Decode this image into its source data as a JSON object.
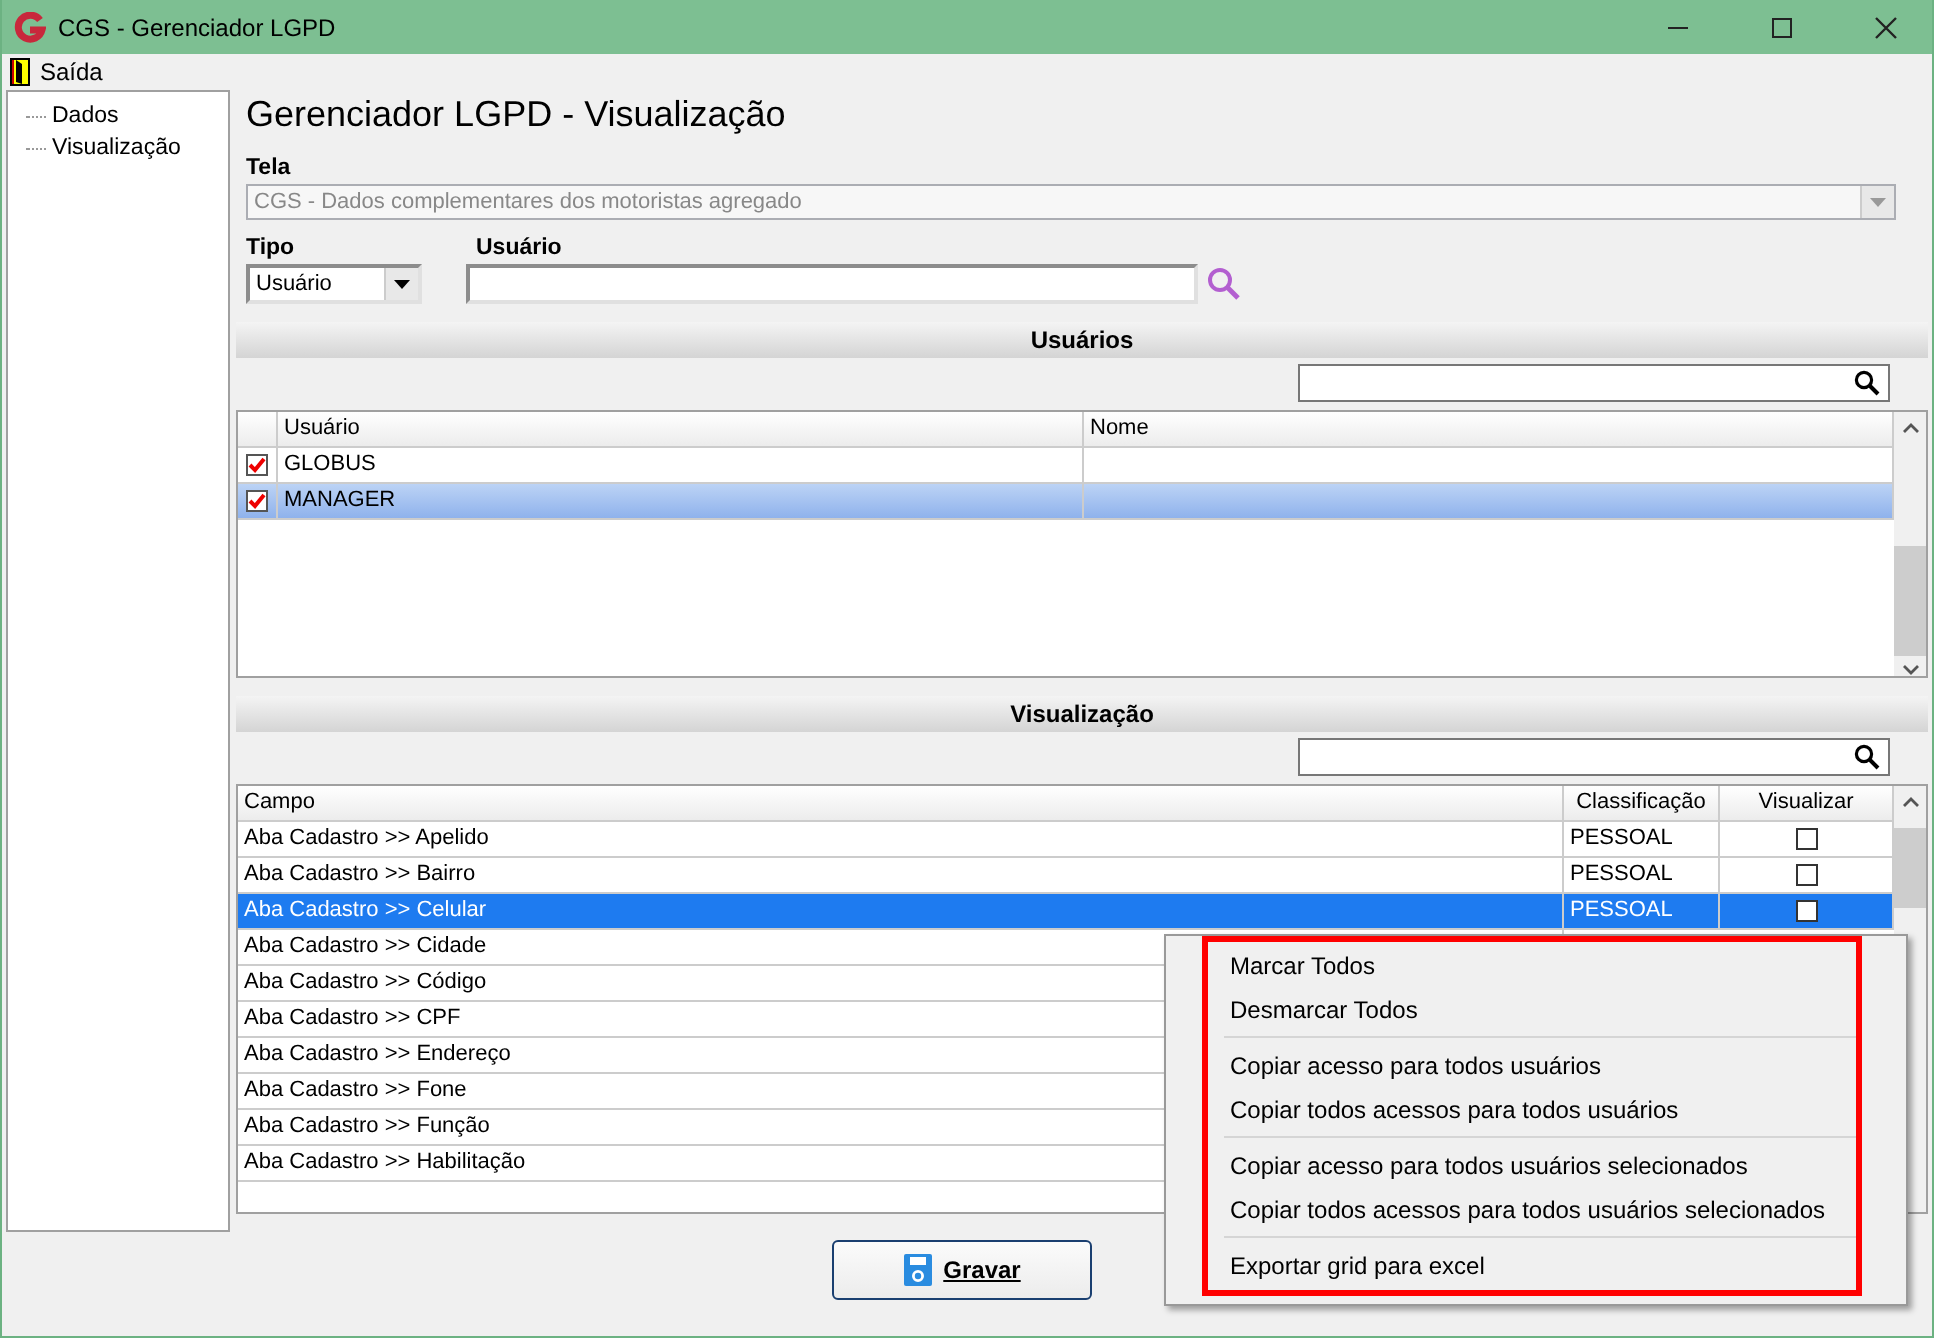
{
  "window": {
    "title": "CGS - Gerenciador LGPD"
  },
  "menu": [
    "Saída"
  ],
  "tree": [
    {
      "label": "Dados"
    },
    {
      "label": "Visualização"
    }
  ],
  "heading": "Gerenciador LGPD - Visualização",
  "tela": {
    "label": "Tela",
    "value": "CGS - Dados complementares dos motoristas agregado",
    "disabled": true
  },
  "tipo": {
    "label": "Tipo",
    "value": "Usuário"
  },
  "usuario": {
    "label": "Usuário"
  },
  "usuarios_section": {
    "title": "Usuários",
    "columns": [
      "Usuário",
      "Nome"
    ],
    "rows": [
      {
        "checked": true,
        "usuario": "GLOBUS",
        "selected": false
      },
      {
        "checked": true,
        "usuario": "MANAGER",
        "selected": true
      }
    ]
  },
  "visualizacao_section": {
    "title": "Visualização",
    "columns": [
      "Campo",
      "Classificação",
      "Visualizar"
    ],
    "rows": [
      {
        "campo": "Aba Cadastro >> Apelido",
        "classificacao": "PESSOAL",
        "visualizar": false,
        "selected": false
      },
      {
        "campo": "Aba Cadastro >> Bairro",
        "classificacao": "PESSOAL",
        "visualizar": false,
        "selected": false
      },
      {
        "campo": "Aba Cadastro >> Celular",
        "classificacao": "PESSOAL",
        "visualizar": false,
        "selected": true
      },
      {
        "campo": "Aba Cadastro >> Cidade",
        "selected": false
      },
      {
        "campo": "Aba Cadastro >> Código",
        "selected": false
      },
      {
        "campo": "Aba Cadastro >> CPF",
        "selected": false
      },
      {
        "campo": "Aba Cadastro >> Endereço",
        "selected": false
      },
      {
        "campo": "Aba Cadastro >> Fone",
        "selected": false
      },
      {
        "campo": "Aba Cadastro >> Função",
        "selected": false
      },
      {
        "campo": "Aba Cadastro >> Habilitação",
        "selected": false
      }
    ]
  },
  "context_menu": [
    {
      "kind": "item",
      "label": "Marcar Todos"
    },
    {
      "kind": "item",
      "label": "Desmarcar Todos"
    },
    {
      "kind": "separator"
    },
    {
      "kind": "item",
      "label": "Copiar acesso para todos usuários"
    },
    {
      "kind": "item",
      "label": "Copiar todos acessos para todos usuários"
    },
    {
      "kind": "separator"
    },
    {
      "kind": "item",
      "label": "Copiar acesso para todos usuários selecionados"
    },
    {
      "kind": "item",
      "label": "Copiar todos acessos para todos usuários selecionados"
    },
    {
      "kind": "separator"
    },
    {
      "kind": "item",
      "label": "Exportar grid para excel"
    }
  ],
  "save_button": {
    "label": "Gravar"
  }
}
